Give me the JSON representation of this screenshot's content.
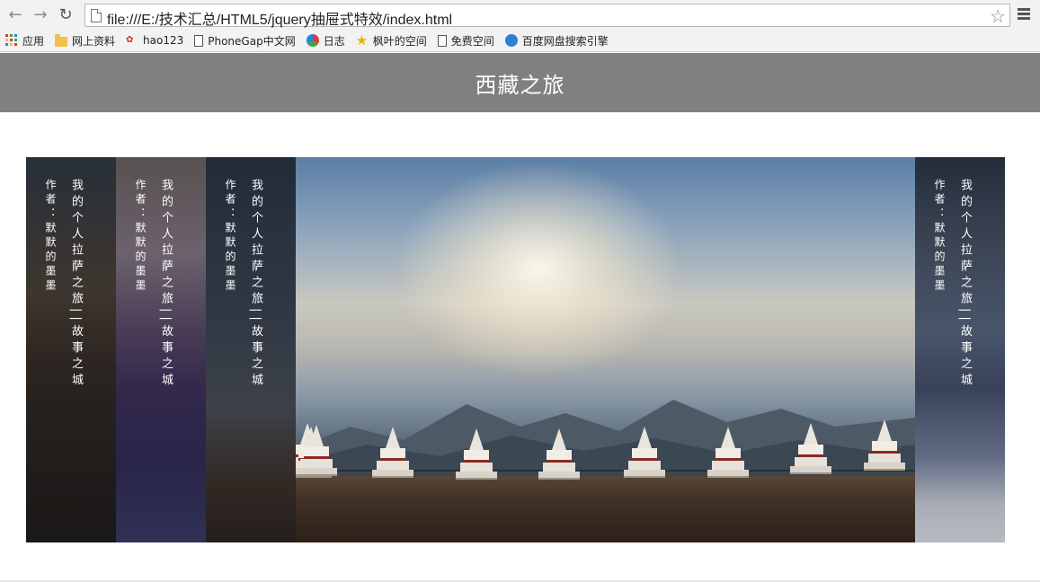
{
  "browser": {
    "url": "file:///E:/技术汇总/HTML5/jquery抽屉式特效/index.html",
    "icons": {
      "back": "arrow-left-icon",
      "forward": "arrow-right-icon",
      "reload": "reload-icon",
      "page": "page-icon",
      "bookmark_star": "star-icon",
      "menu": "hamburger-menu-icon"
    },
    "bookmarks": [
      {
        "label": "应用",
        "icon": "apps-grid-icon"
      },
      {
        "label": "网上资料",
        "icon": "folder-icon"
      },
      {
        "label": "hao123",
        "icon": "hao123-icon"
      },
      {
        "label": "PhoneGap中文网",
        "icon": "page-icon"
      },
      {
        "label": "日志",
        "icon": "colorful-orb-icon"
      },
      {
        "label": "枫叶的空间",
        "icon": "star-icon"
      },
      {
        "label": "免费空间",
        "icon": "page-icon"
      },
      {
        "label": "百度网盘搜索引擎",
        "icon": "cloud-icon"
      }
    ]
  },
  "page": {
    "header_title": "西藏之旅",
    "header_color": "#808080"
  },
  "accordion": {
    "panels": [
      {
        "title": "我的个人拉萨之旅||故事之城",
        "author": "作者：默默的墨墨"
      },
      {
        "title": "我的个人拉萨之旅||故事之城",
        "author": "作者：默默的墨墨"
      },
      {
        "title": "我的个人拉萨之旅||故事之城",
        "author": "作者：默默的墨墨"
      },
      {
        "title": "",
        "author": ""
      },
      {
        "title": "我的个人拉萨之旅||故事之城",
        "author": "作者：默默的墨墨"
      }
    ]
  }
}
